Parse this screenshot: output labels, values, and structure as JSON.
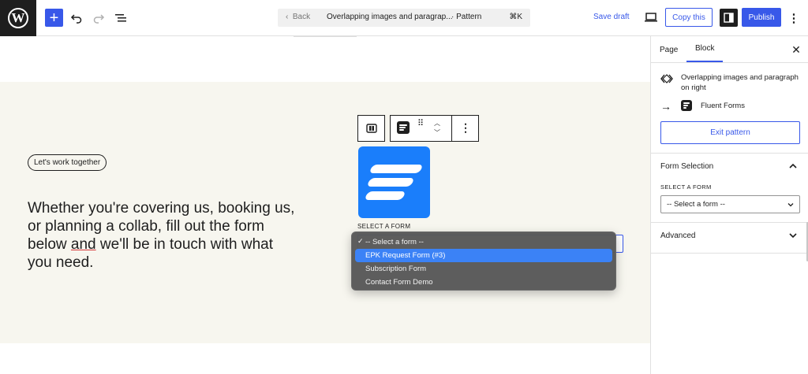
{
  "topbar": {
    "command_bar": {
      "back_label": "Back",
      "title": "Overlapping images and paragrap...",
      "type_label": "· Pattern",
      "shortcut": "⌘K"
    },
    "save_draft_label": "Save draft",
    "copy_label": "Copy this",
    "publish_label": "Publish",
    "accent_color": "#3858e9"
  },
  "canvas": {
    "pill_label": "Let's work together",
    "heading": {
      "before": "Whether you're covering us, booking us, or planning a collab, fill out the form below ",
      "underlined": "and",
      "after": " we'll be in touch with what you need."
    },
    "section_background": "#f7f6ef",
    "fluent_logo_color": "#1a7efb",
    "select_label": "SELECT A FORM",
    "dropdown": {
      "options": [
        {
          "label": "-- Select a form --",
          "checked": true,
          "highlighted": false
        },
        {
          "label": "EPK Request Form (#3)",
          "checked": false,
          "highlighted": true
        },
        {
          "label": "Subscription Form",
          "checked": false,
          "highlighted": false
        },
        {
          "label": "Contact Form Demo",
          "checked": false,
          "highlighted": false
        }
      ]
    }
  },
  "sidebar": {
    "tabs": [
      {
        "label": "Page",
        "active": false
      },
      {
        "label": "Block",
        "active": true
      }
    ],
    "pattern_name": "Overlapping images and paragraph on right",
    "child_block_name": "Fluent Forms",
    "exit_pattern_label": "Exit pattern",
    "form_selection": {
      "title": "Form Selection",
      "expanded": true,
      "select_label": "SELECT A FORM",
      "select_value": "-- Select a form --"
    },
    "advanced": {
      "title": "Advanced",
      "expanded": false
    }
  }
}
